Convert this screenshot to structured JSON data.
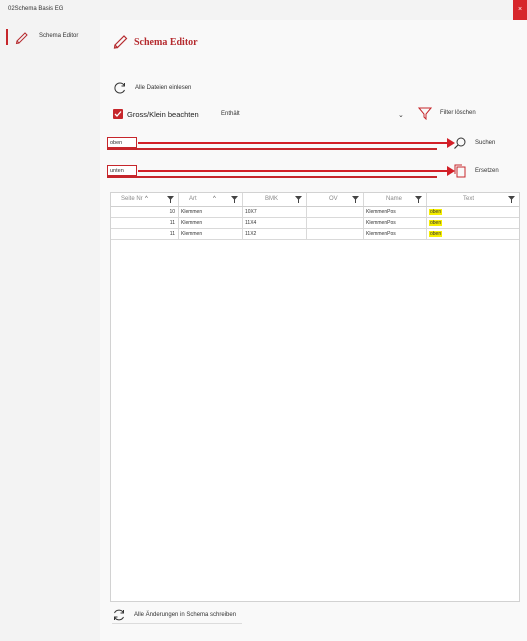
{
  "window": {
    "title": "02Schema Basis EG",
    "close_label": "×"
  },
  "sidebar": {
    "items": [
      {
        "label": "Schema Editor",
        "icon": "pencil-icon"
      }
    ]
  },
  "page": {
    "title": "Schema Editor"
  },
  "toolbar": {
    "read_all_label": "Alle Dateien einlesen",
    "case_sensitive_label": "Gross/Klein beachten",
    "case_sensitive_checked": true,
    "match_mode": "Enthält",
    "clear_filter_label": "Filter löschen",
    "search_label": "Suchen",
    "replace_label": "Ersetzen"
  },
  "search": {
    "value": "oben"
  },
  "replace": {
    "value": "unten"
  },
  "table": {
    "columns": [
      "Seite Nr",
      "Art",
      "BMK",
      "OV",
      "Name",
      "Text"
    ],
    "rows": [
      {
        "seite": "10",
        "art": "Klemmen",
        "bmk": "10X7",
        "ov": "",
        "name": "KlemmenPos",
        "text": "oben"
      },
      {
        "seite": "11",
        "art": "Klemmen",
        "bmk": "11X4",
        "ov": "",
        "name": "KlemmenPos",
        "text": "oben"
      },
      {
        "seite": "11",
        "art": "Klemmen",
        "bmk": "11X2",
        "ov": "",
        "name": "KlemmenPos",
        "text": "oben"
      }
    ]
  },
  "footer": {
    "write_label": "Alle Änderungen in Schema schreiben"
  },
  "colors": {
    "accent": "#c6262b",
    "highlight": "#f5ee00",
    "close": "#d7262b"
  }
}
